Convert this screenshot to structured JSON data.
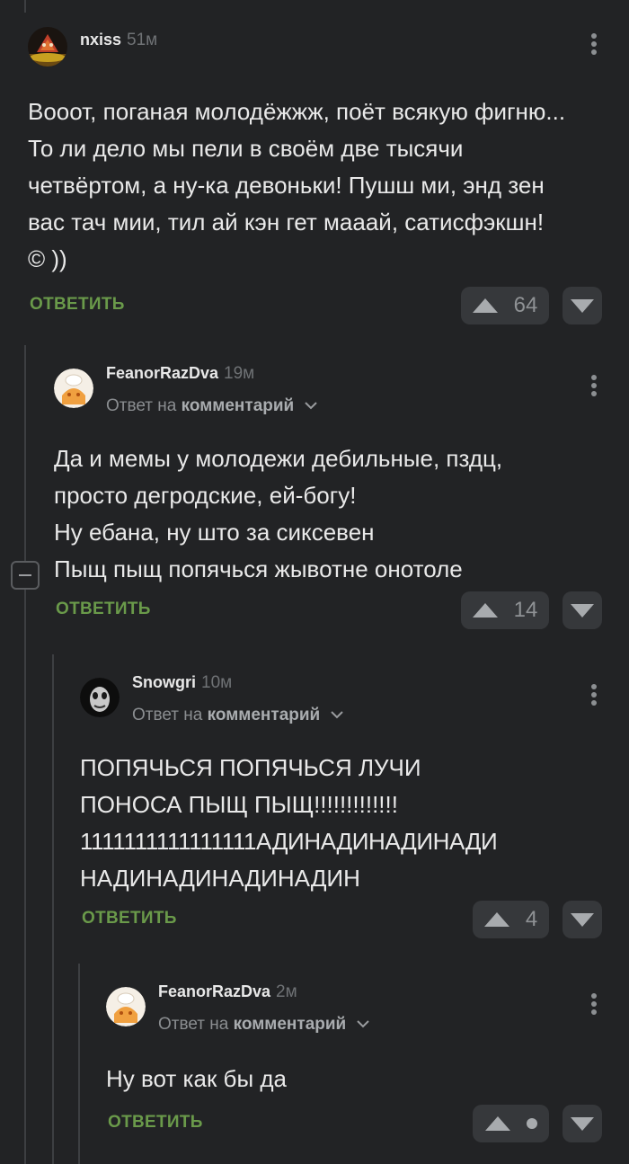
{
  "comments": [
    {
      "username": "nxiss",
      "time": "51м",
      "text": "Вооот, поганая молодёжжж, поёт всякую фигню... То ли дело мы пели в своём две тысячи четвёртом, а ну-ка девоньки! Пушш ми, энд зен вас тач мии, тил ай кэн гет мааай, сатисфэкшн! © ))",
      "reply_label": "ОТВЕТИТЬ",
      "votes": "64"
    },
    {
      "username": "FeanorRazDva",
      "time": "19м",
      "reply_prefix": "Ответ на",
      "reply_target": "комментарий",
      "text_lines": [
        "Да и мемы у молодежи дебильные, пздц,",
        "просто дегродские, ей-богу!",
        "Ну ебана, ну што за сиксевен",
        "Пыщ пыщ попячься жывотне онотоле"
      ],
      "reply_label": "ОТВЕТИТЬ",
      "votes": "14"
    },
    {
      "username": "Snowgri",
      "time": "10м",
      "reply_prefix": "Ответ на",
      "reply_target": "комментарий",
      "text_lines": [
        "ПОПЯЧЬСЯ ПОПЯЧЬСЯ ЛУЧИ",
        "ПОНОСА ПЫЩ ПЫЩ!!!!!!!!!!!!!",
        "1111111111111111АДИНАДИНАДИНАДИ",
        "НАДИНАДИНАДИНАДИН"
      ],
      "reply_label": "ОТВЕТИТЬ",
      "votes": "4"
    },
    {
      "username": "FeanorRazDva",
      "time": "2м",
      "reply_prefix": "Ответ на",
      "reply_target": "комментарий",
      "text": "Ну вот как бы да",
      "reply_label": "ОТВЕТИТЬ",
      "votes": ""
    }
  ],
  "icons": {
    "upvote": "triangle-up-icon",
    "downvote": "triangle-down-icon",
    "menu": "vertical-dots-icon",
    "collapse": "minus-box-icon"
  },
  "colors": {
    "background": "#222325",
    "reply_green": "#6a9a4a",
    "vote_bg": "#36383b"
  }
}
